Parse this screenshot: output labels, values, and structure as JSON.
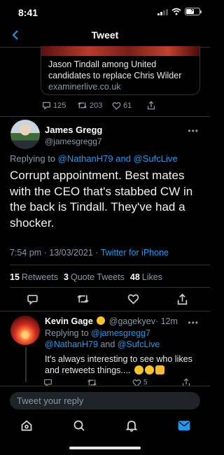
{
  "status_bar": {
    "time": "8:41"
  },
  "header": {
    "title": "Tweet"
  },
  "quoted_card": {
    "title": "Jason Tindall among United candidates to replace Chris Wilder",
    "domain": "examinerlive.co.uk"
  },
  "parent_tweet_actions": {
    "replies": "125",
    "retweets": "203",
    "likes": "61"
  },
  "main_tweet": {
    "name": "James Gregg",
    "handle": "@jamesgregg7",
    "replying_prefix": "Replying to ",
    "replying_user1": "@NathanH79",
    "replying_and": " and ",
    "replying_user2": "@SufcLive",
    "text": "Corrupt appointment. Best mates with the CEO that's stabbed CW in the back is Tindall. They've had a shocker.",
    "time": "7:54 pm · 13/03/2021 · ",
    "source": "Twitter for iPhone",
    "stats": {
      "retweets_count": "15",
      "retweets_label": "Retweets",
      "quotes_count": "3",
      "quotes_label": "Quote Tweets",
      "likes_count": "48",
      "likes_label": "Likes"
    }
  },
  "reply_tweet": {
    "name": "Kevin Gage",
    "handle": "@gagekyev",
    "time": "· 12m",
    "replying_prefix": "Replying to ",
    "replying_user1": "@jamesgregg7",
    "replying_user2": "@NathanH79",
    "replying_and": " and ",
    "replying_user3": "@SufcLive",
    "text": "It's always interesting to see who likes and retweets  things....",
    "likes": "5"
  },
  "composer": {
    "placeholder": "Tweet your reply"
  },
  "colors": {
    "accent": "#1d9bf0",
    "background": "#000000",
    "secondary_text": "#8b98a5"
  }
}
